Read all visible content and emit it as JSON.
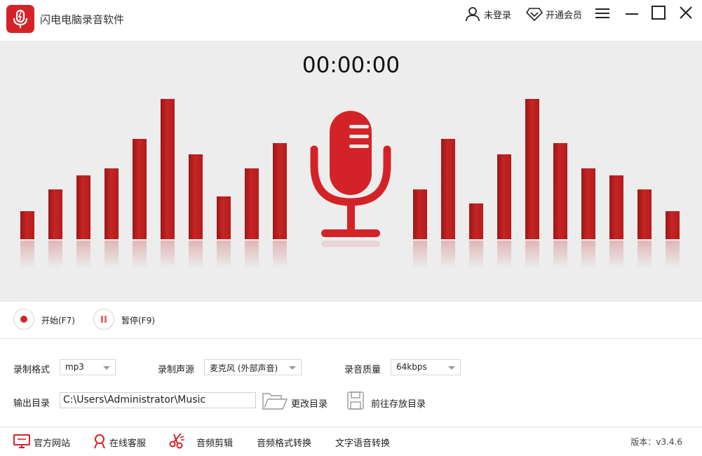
{
  "app": {
    "title": "闪电电脑录音软件"
  },
  "titlebar": {
    "login_label": "未登录",
    "vip_label": "开通会员"
  },
  "display": {
    "timer": "00:00:00",
    "levels_left": [
      0.2,
      0.35,
      0.45,
      0.5,
      0.71,
      0.99,
      0.6,
      0.3,
      0.5,
      0.68
    ],
    "levels_right": [
      0.35,
      0.71,
      0.25,
      0.6,
      0.99,
      0.68,
      0.5,
      0.45,
      0.35,
      0.2
    ]
  },
  "controls": {
    "start_label": "开始(F7)",
    "pause_label": "暂停(F9)"
  },
  "settings": {
    "format_label": "录制格式",
    "format_value": "mp3",
    "source_label": "录制声源",
    "source_value": "麦克风 (外部声音)",
    "quality_label": "录音质量",
    "quality_value": "64kbps",
    "output_label": "输出目录",
    "output_path": "C:\\Users\\Administrator\\Music",
    "change_dir_label": "更改目录",
    "open_dir_label": "前往存放目录"
  },
  "footer": {
    "website_label": "官方网站",
    "support_label": "在线客服",
    "edit_label": "音频剪辑",
    "convert_label": "音频格式转换",
    "tts_label": "文字语音转换",
    "version": "版本：v3.4.6"
  },
  "colors": {
    "accent": "#d42328",
    "bar": "#b51c1c",
    "panel": "#ededed"
  },
  "icons": [
    "app-logo-icon",
    "user-icon",
    "diamond-icon",
    "menu-icon",
    "minimize-icon",
    "maximize-icon",
    "close-icon",
    "microphone-icon",
    "record-icon",
    "pause-icon",
    "folder-icon",
    "save-icon",
    "monitor-icon",
    "support-icon",
    "scissors-icon"
  ]
}
